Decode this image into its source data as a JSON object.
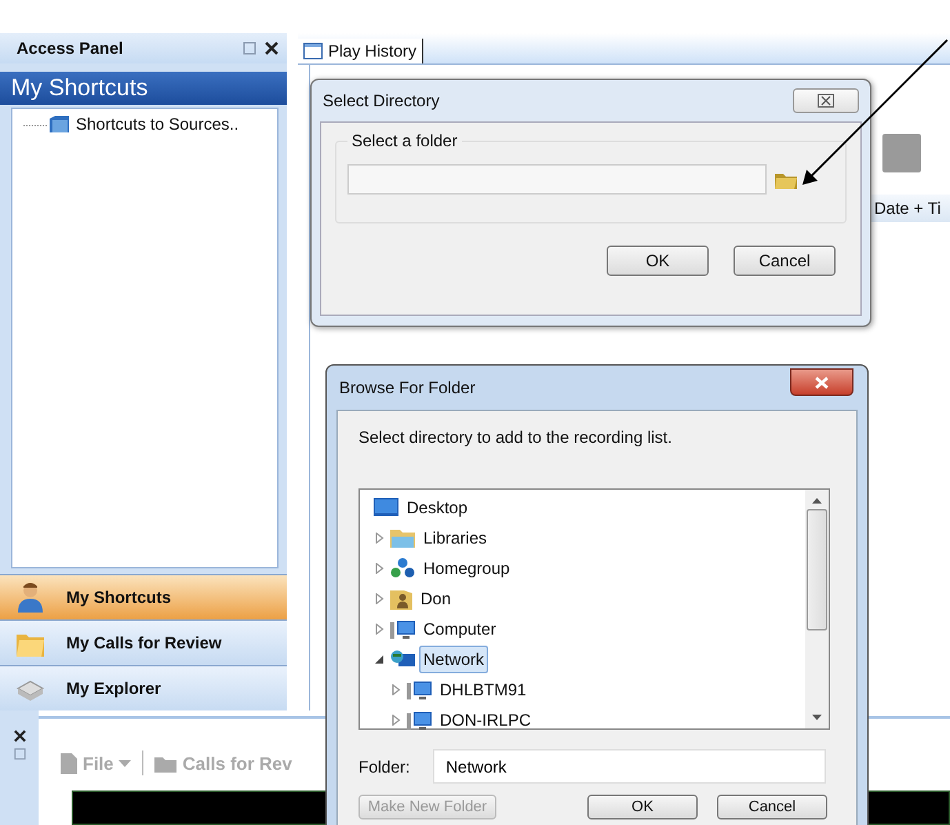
{
  "access_panel": {
    "title": "Access Panel",
    "header": "My Shortcuts",
    "tree": [
      {
        "label": "Shortcuts to Sources.."
      }
    ],
    "nav": [
      {
        "label": "My Shortcuts",
        "selected": true,
        "kind": "person"
      },
      {
        "label": "My Calls for Review",
        "selected": false,
        "kind": "folder"
      },
      {
        "label": "My Explorer",
        "selected": false,
        "kind": "drive"
      }
    ]
  },
  "tabs": [
    {
      "label": "Play History",
      "selected": true
    }
  ],
  "table": {
    "columns": [
      "Date + Ti"
    ]
  },
  "bottom_panel": {
    "toolbar": [
      {
        "label": "File",
        "kind": "file"
      },
      {
        "label": "Calls for Rev",
        "kind": "calls"
      }
    ]
  },
  "select_dialog": {
    "title": "Select Directory",
    "group": "Select a folder",
    "buttons": [
      "OK",
      "Cancel"
    ]
  },
  "browse_dialog": {
    "title": "Browse For Folder",
    "prompt": "Select directory to add to the recording list.",
    "tree": [
      {
        "label": "Desktop",
        "kind": "desktop",
        "selected": false,
        "children": [
          {
            "label": "Libraries",
            "kind": "libraries",
            "selected": false,
            "expanded": false
          },
          {
            "label": "Homegroup",
            "kind": "homegroup",
            "selected": false,
            "expanded": false
          },
          {
            "label": "Don",
            "kind": "user",
            "selected": false,
            "expanded": false
          },
          {
            "label": "Computer",
            "kind": "computer",
            "selected": false,
            "expanded": false
          },
          {
            "label": "Network",
            "kind": "network",
            "selected": true,
            "expanded": true,
            "children": [
              {
                "label": "DHLBTM91",
                "kind": "computer",
                "selected": false,
                "expanded": false
              },
              {
                "label": "DON-IRLPC",
                "kind": "computer",
                "selected": false,
                "expanded": false
              }
            ]
          }
        ]
      }
    ],
    "folder_label": "Folder:",
    "folder_value": "Network",
    "buttons": [
      {
        "label": "Make New Folder",
        "disabled": true
      },
      {
        "label": "OK",
        "disabled": false
      },
      {
        "label": "Cancel",
        "disabled": false
      }
    ]
  }
}
